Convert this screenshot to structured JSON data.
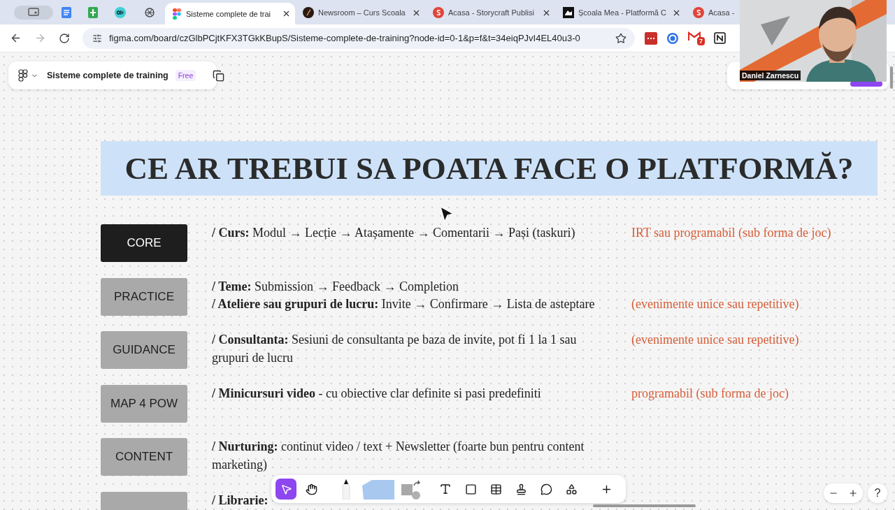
{
  "browser": {
    "tabs": [
      {
        "kind": "pinned",
        "selected": false
      },
      {
        "kind": "pinned",
        "selected": false
      },
      {
        "kind": "pinned",
        "selected": false
      },
      {
        "kind": "pinned",
        "selected": false
      },
      {
        "kind": "pinned",
        "selected": false
      },
      {
        "kind": "page",
        "title": "Sisteme complete de trai",
        "selected": true
      },
      {
        "kind": "page",
        "title": "Newsroom – Curs Scoala",
        "selected": false
      },
      {
        "kind": "page",
        "title": "Acasa - Storycraft Publisi",
        "selected": false
      },
      {
        "kind": "page",
        "title": "Școala Mea - Platformă C",
        "selected": false
      },
      {
        "kind": "page",
        "title": "Acasa -",
        "selected": false
      }
    ],
    "address": {
      "url": "figma.com/board/czGlbPCjtKFX3TGkKBupS/Sisteme-complete-de-training?node-id=0-1&p=f&t=34eiqPJvI4EL40u3-0",
      "forward_disabled": true
    },
    "extensions": {
      "mail_badge": "7"
    }
  },
  "figma": {
    "file_name": "Sisteme complete de training",
    "plan": "Free"
  },
  "board": {
    "title": "CE AR TREBUI SA POATA FACE O PLATFORMĂ?",
    "rows": [
      {
        "label": "CORE",
        "kind": "dark",
        "lines": [
          {
            "text": "**/ Curs:** Modul → Lecție → Atașamente → Comentarii → Pași (taskuri)",
            "note": "IRT sau programabil (sub forma de joc)"
          }
        ]
      },
      {
        "label": "PRACTICE",
        "kind": "gray",
        "lines": [
          {
            "text": "**/ Teme:** Submission → Feedback → Completion"
          },
          {
            "text": "**/ Ateliere sau grupuri de lucru:** Invite → Confirmare → Lista de asteptare",
            "note": "(evenimente unice sau repetitive)"
          }
        ]
      },
      {
        "label": "GUIDANCE",
        "kind": "gray",
        "lines": [
          {
            "text": "**/ Consultanta:** Sesiuni de consultanta pe baza de invite, pot fi 1 la 1 sau grupuri de lucru",
            "note": "(evenimente unice sau repetitive)"
          }
        ]
      },
      {
        "label": "MAP 4 POW",
        "kind": "gray",
        "lines": [
          {
            "text": "**/ Minicursuri video** - cu obiective clar definite si pasi predefiniti",
            "note": "programabil (sub forma de joc)"
          }
        ]
      },
      {
        "label": "CONTENT",
        "kind": "gray",
        "lines": [
          {
            "text": "**/ Nurturing:** continut video / text + Newsletter (foarte bun pentru content marketing)"
          }
        ]
      },
      {
        "kind": "gray",
        "lines": [
          {
            "text": "**/ Librarie:**"
          }
        ]
      }
    ]
  },
  "toolbar": {
    "tools": [
      {
        "selected": true
      },
      {
        "selected": false
      },
      {
        "selected": false
      },
      {
        "selected": false
      },
      {
        "selected": false
      },
      {
        "selected": false
      },
      {
        "selected": false
      },
      {
        "selected": false
      },
      {
        "selected": false
      },
      {
        "selected": false
      },
      {
        "selected": false
      },
      {
        "selected": false
      }
    ]
  },
  "zoom": {
    "help": "?"
  },
  "webcam": {
    "name": "Daniel Zarnescu"
  }
}
